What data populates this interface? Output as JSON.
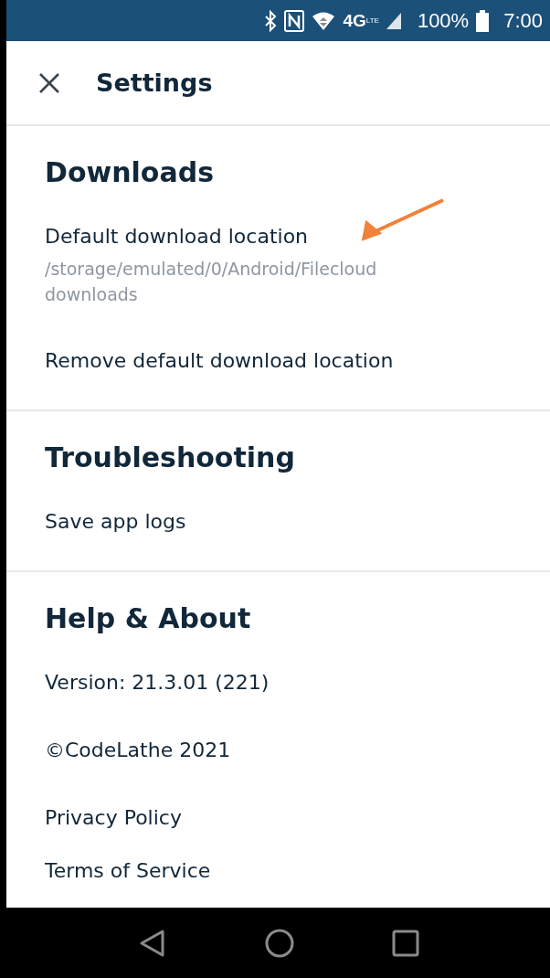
{
  "status_bar": {
    "network": "4G",
    "network_sub": "LTE",
    "battery": "100%",
    "time": "7:00"
  },
  "app_bar": {
    "title": "Settings"
  },
  "sections": [
    {
      "title": "Downloads",
      "items": [
        {
          "label": "Default download location",
          "subtitle": "/storage/emulated/0/Android/Filecloud downloads",
          "annotated": true
        },
        {
          "label": "Remove default download location",
          "annotated": false
        }
      ]
    },
    {
      "title": "Troubleshooting",
      "items": [
        {
          "label": "Save app logs",
          "annotated": false
        }
      ]
    },
    {
      "title": "Help & About",
      "items": [
        {
          "label": "Version: 21.3.01 (221)",
          "annotated": false
        },
        {
          "label": "©CodeLathe 2021",
          "annotated": false
        },
        {
          "label": "Privacy Policy",
          "annotated": false
        },
        {
          "label": "Terms of Service",
          "annotated": false
        }
      ]
    }
  ]
}
